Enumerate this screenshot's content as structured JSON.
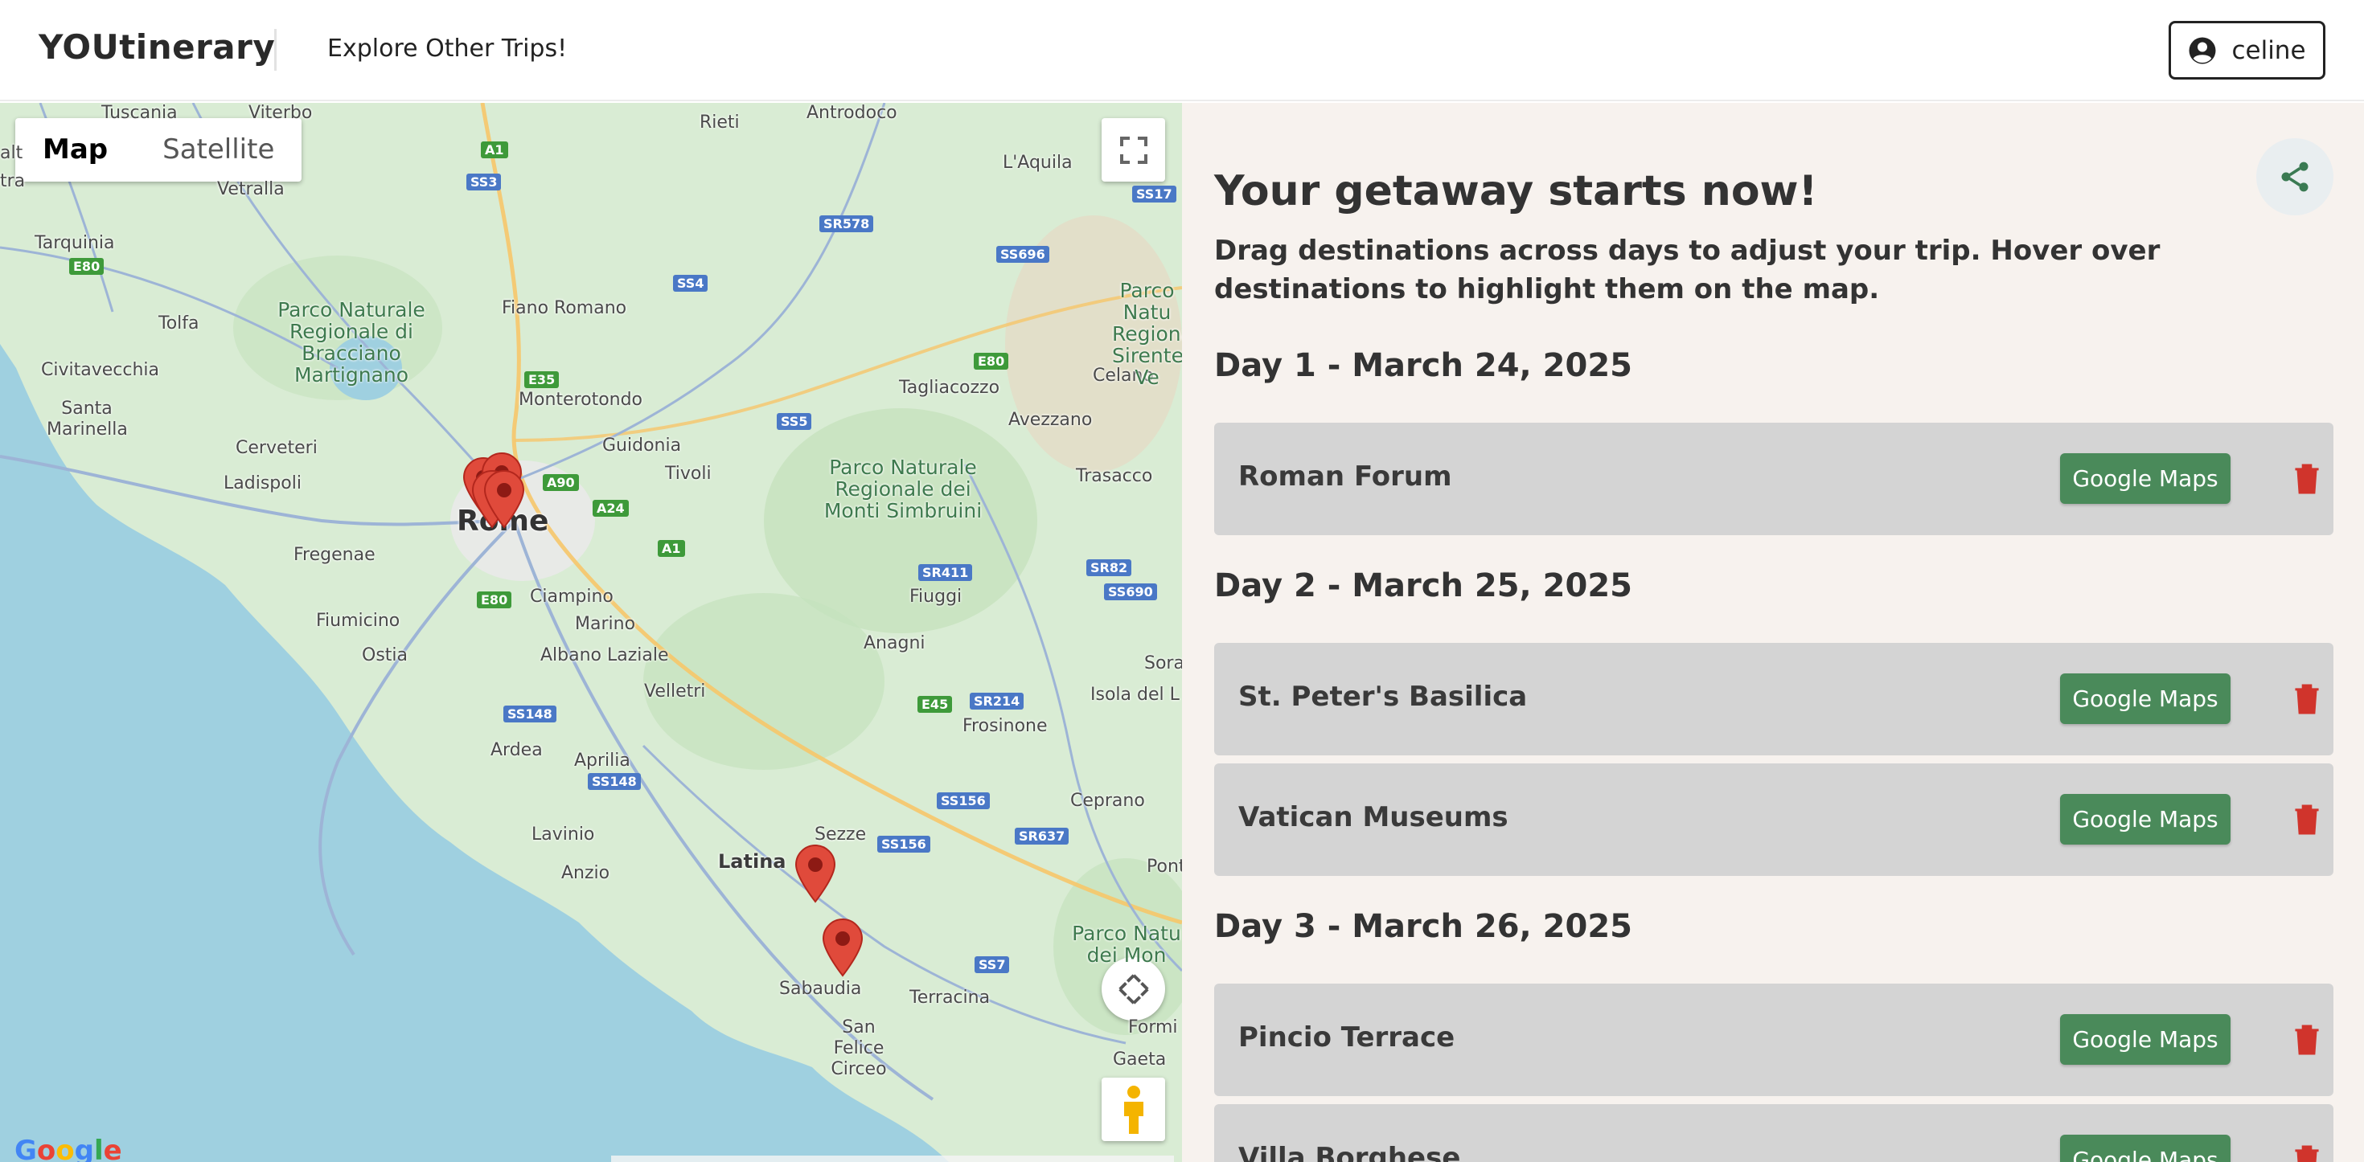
{
  "header": {
    "brand": "YOUtinerary",
    "nav_link": "Explore Other Trips!",
    "user_name": "celine"
  },
  "map": {
    "type_options": [
      "Map",
      "Satellite"
    ],
    "active_type": "Map",
    "attribution": "Google",
    "labels": {
      "rome": "Rome",
      "latina": "Latina",
      "tuscania": "Tuscania",
      "viterbo": "Viterbo",
      "rieti": "Rieti",
      "antrodoco": "Antrodoco",
      "laquila": "L'Aquila",
      "vetralla": "Vetralla",
      "tarquinia": "Tarquinia",
      "tolfa": "Tolfa",
      "civitavecchia": "Civitavecchia",
      "santa_marinella": "Santa Marinella",
      "cerveteri": "Cerveteri",
      "ladispoli": "Ladispoli",
      "fregenae": "Fregenae",
      "fiumicino": "Fiumicino",
      "ostia": "Ostia",
      "fiano_romano": "Fiano Romano",
      "monterotondo": "Monterotondo",
      "guidonia": "Guidonia",
      "tivoli": "Tivoli",
      "tagliacozzo": "Tagliacozzo",
      "avezzano": "Avezzano",
      "celano": "Celano",
      "trasacco": "Trasacco",
      "ciampino": "Ciampino",
      "marino": "Marino",
      "albano": "Albano Laziale",
      "fiuggi": "Fiuggi",
      "anagni": "Anagni",
      "velletri": "Velletri",
      "frosinone": "Frosinone",
      "isola": "Isola del L",
      "sora": "Sora",
      "ardea": "Ardea",
      "aprilia": "Aprilia",
      "lavinio": "Lavinio",
      "anzio": "Anzio",
      "sezze": "Sezze",
      "ceprano": "Ceprano",
      "pont": "Pont",
      "sabaudia": "Sabaudia",
      "terracina": "Terracina",
      "san_felice": "San Felice Circeo",
      "formia": "Formi",
      "gaeta": "Gaeta",
      "alt": "alt",
      "tra": "tra",
      "park_bracciano": "Parco Naturale Regionale di Bracciano Martignano",
      "park_simbruini": "Parco Naturale Regionale dei Monti Simbruini",
      "park_sirente": "Parco Natu Regionale Sirente-Ve",
      "park_aurunci": "Parco Natu dei Mon"
    },
    "roads": {
      "a1": "A1",
      "ss3": "SS3",
      "sr578": "SR578",
      "ss696": "SS696",
      "ss17": "SS17",
      "ss4": "SS4",
      "e80a": "E80",
      "e80b": "E80",
      "e80c": "E80",
      "e35": "E35",
      "a90": "A90",
      "a24": "A24",
      "a1b": "A1",
      "ss5": "SS5",
      "sr411": "SR411",
      "sr82": "SR82",
      "ss690": "SS690",
      "e45": "E45",
      "sr214": "SR214",
      "ss148a": "SS148",
      "ss148b": "SS148",
      "ss156a": "SS156",
      "ss156b": "SS156",
      "sr637": "SR637",
      "ss7": "SS7"
    }
  },
  "itinerary": {
    "title": "Your getaway starts now!",
    "description": "Drag destinations across days to adjust your trip. Hover over destinations to highlight them on the map.",
    "button_label": "Google Maps",
    "days": [
      {
        "heading": "Day 1 - March 24, 2025",
        "destinations": [
          "Roman Forum"
        ]
      },
      {
        "heading": "Day 2 - March 25, 2025",
        "destinations": [
          "St. Peter's Basilica",
          "Vatican Museums"
        ]
      },
      {
        "heading": "Day 3 - March 26, 2025",
        "destinations": [
          "Pincio Terrace",
          "Villa Borghese"
        ]
      }
    ]
  },
  "colors": {
    "accent_green": "#4a8a5a",
    "danger_red": "#d0342c",
    "panel_bg": "#f7f2ee",
    "card_bg": "#d4d4d4",
    "map_land": "#d9ecd4",
    "map_water": "#9fd0e0",
    "pin": "#e04a3b"
  },
  "icons": {
    "user": "account-circle-icon",
    "share": "share-icon",
    "trash": "trash-icon",
    "fullscreen": "fullscreen-icon",
    "pan": "pan-arrows-icon",
    "pegman": "street-view-pegman-icon",
    "pin": "map-pin-icon"
  }
}
